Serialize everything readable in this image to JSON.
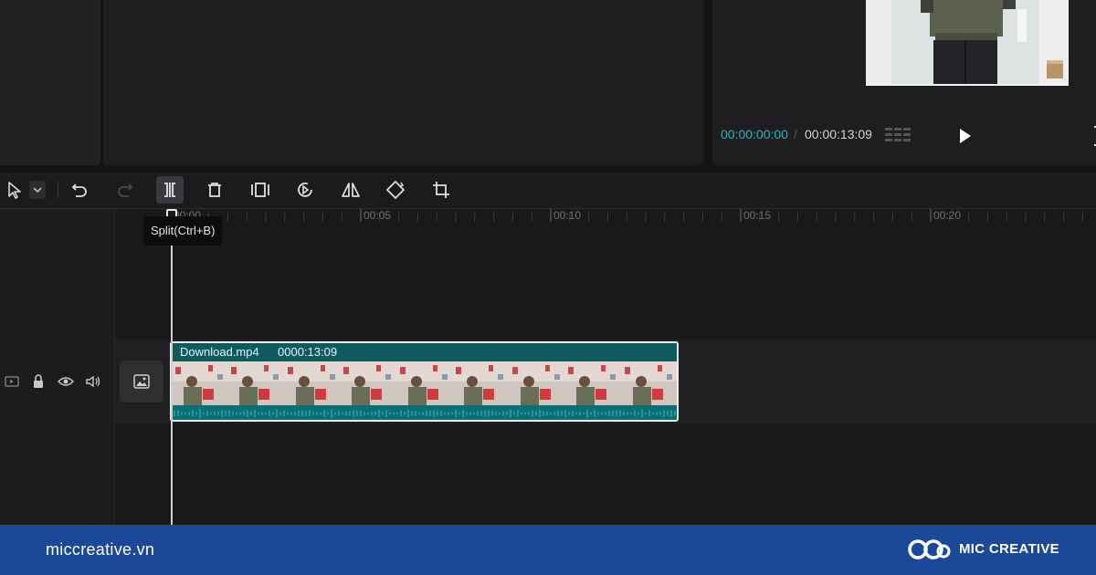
{
  "player": {
    "current_time": "00:00:00:00",
    "separator": "/",
    "total_time": "00:00:13:09"
  },
  "toolbar": {
    "tools": [
      {
        "name": "select-tool",
        "icon": "cursor-icon"
      },
      {
        "name": "undo",
        "icon": "undo-icon"
      },
      {
        "name": "redo",
        "icon": "redo-icon"
      },
      {
        "name": "split",
        "icon": "split-icon"
      },
      {
        "name": "delete",
        "icon": "trash-icon"
      },
      {
        "name": "freeze",
        "icon": "freeze-frame-icon"
      },
      {
        "name": "reverse",
        "icon": "reverse-play-icon"
      },
      {
        "name": "mirror",
        "icon": "mirror-icon"
      },
      {
        "name": "rotate",
        "icon": "rotate-icon"
      },
      {
        "name": "crop",
        "icon": "crop-icon"
      }
    ],
    "tooltip": "Split(Ctrl+B)"
  },
  "timeline": {
    "ruler_labels": [
      "00:00",
      "00:05",
      "00:10",
      "00:15",
      "00:20"
    ],
    "clip": {
      "name": "Download.mp4",
      "duration": "0000:13:09"
    }
  },
  "footer": {
    "website": "miccreative.vn",
    "brand": "MIC CREATIVE"
  },
  "colors": {
    "accent": "#1fb7c7",
    "clip": "#0f5a60",
    "footer": "#1c489a"
  }
}
